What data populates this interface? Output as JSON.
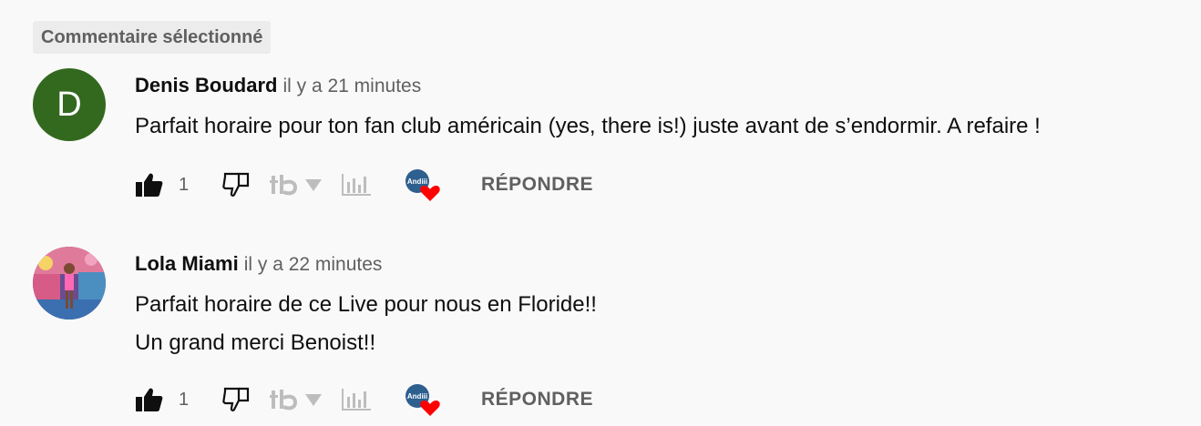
{
  "badge": "Commentaire sélectionné",
  "comments": [
    {
      "avatar_letter": "D",
      "avatar_color": "#33691e",
      "author": "Denis Boudard",
      "time": "il y a 21 minutes",
      "lines": [
        "Parfait horaire pour ton fan club américain (yes, there is!) juste avant de s’endormir. A refaire !"
      ],
      "likes": "1",
      "reply_label": "RÉPONDRE"
    },
    {
      "avatar_letter": "",
      "author": "Lola Miami",
      "time": "il y a 22 minutes",
      "lines": [
        "Parfait horaire de ce Live pour nous en Floride!!",
        "Un grand merci Benoist!!"
      ],
      "likes": "1",
      "reply_label": "RÉPONDRE"
    }
  ],
  "creator_heart": {
    "avatar_text": "Andiii",
    "heart_color": "#ff0000"
  },
  "icons": [
    "thumbs-up-icon",
    "thumbs-down-icon",
    "tubebuddy-icon",
    "dropdown-triangle-icon",
    "analytics-bars-icon",
    "heart-icon"
  ]
}
